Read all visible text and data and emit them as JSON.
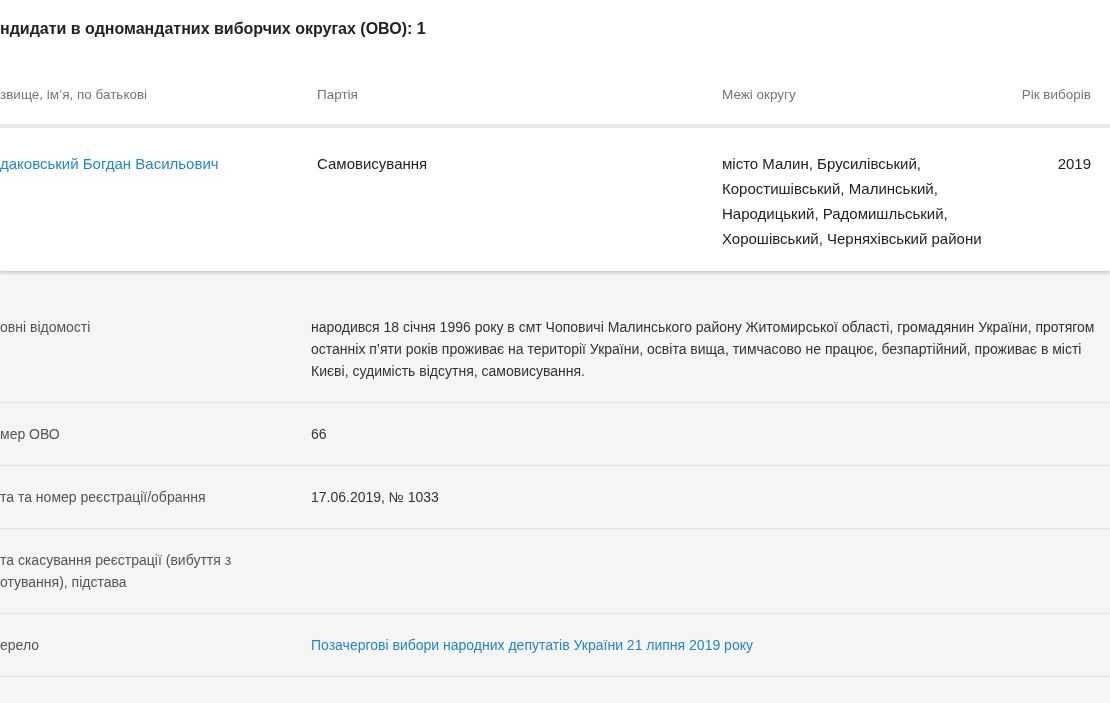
{
  "section_title": "ндидати в одномандатних виборчих округах (ОВО): 1",
  "table": {
    "columns": [
      "звище, ім’я, по батькові",
      "Партія",
      "Межі округу",
      "Рік виборів"
    ],
    "rows": [
      {
        "name": "даковський Богдан Васильович",
        "party": "Самовисування",
        "district": "місто Малин, Брусилівський, Коростишівський, Малинський, Народицький, Радомишльський, Хорошівський, Черняхівський райони",
        "year": "2019"
      }
    ]
  },
  "details": [
    {
      "label": "овні відомості",
      "value": "народився 18 січня 1996 року в смт Чоповичі Малинського району Житомирської області, громадянин України, протягом останніх п’яти років проживає на території України, освіта вища, тимчасово не працює, безпартійний, проживає в місті Києві, судимість відсутня, самовисування.",
      "kind": "text"
    },
    {
      "label": "мер ОВО",
      "value": "66",
      "kind": "text"
    },
    {
      "label": "та та номер реєстрації/обрання",
      "value": "17.06.2019, № 1033",
      "kind": "text"
    },
    {
      "label": "та скасування реєстрації (вибуття з отування), підстава",
      "kind": "empty"
    },
    {
      "label": "ерело",
      "value": "Позачергові вибори народних депутатів України 21 липня 2019 року",
      "kind": "link"
    }
  ]
}
